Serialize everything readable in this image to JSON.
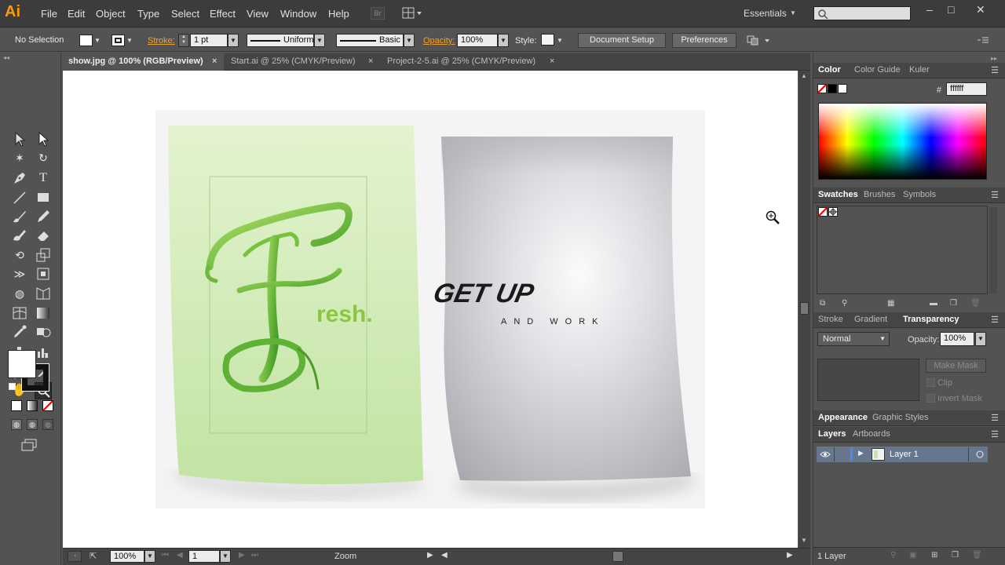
{
  "app": {
    "logo": "Ai"
  },
  "menu": [
    "File",
    "Edit",
    "Object",
    "Type",
    "Select",
    "Effect",
    "View",
    "Window",
    "Help"
  ],
  "bridge_label": "Br",
  "workspace": "Essentials",
  "window_controls": {
    "minimize": "–",
    "restore": "□",
    "close": "✕"
  },
  "control": {
    "selection": "No Selection",
    "stroke_label": "Stroke:",
    "stroke_weight": "1 pt",
    "profile": "Uniform",
    "brush": "Basic",
    "opacity_label": "Opacity:",
    "opacity": "100%",
    "style_label": "Style:",
    "document_setup": "Document Setup",
    "preferences": "Preferences"
  },
  "tabs": [
    {
      "label": "show.jpg @ 100% (RGB/Preview)",
      "close": "×"
    },
    {
      "label": "Start.ai @ 25% (CMYK/Preview)",
      "close": "×"
    },
    {
      "label": "Project-2-5.ai @ 25% (CMYK/Preview)",
      "close": "×"
    }
  ],
  "artwork": {
    "fresh_text": "resh.",
    "getup_text": "GET UP",
    "and_work": "AND WORK"
  },
  "status": {
    "zoom": "100%",
    "artboard": "1",
    "tool": "Zoom"
  },
  "color_panel": {
    "tabs": [
      "Color",
      "Color Guide",
      "Kuler"
    ],
    "hash": "#",
    "hex": "ffffff"
  },
  "swatches_panel": {
    "tabs": [
      "Swatches",
      "Brushes",
      "Symbols"
    ]
  },
  "transparency_panel": {
    "tabs": [
      "Stroke",
      "Gradient",
      "Transparency"
    ],
    "mode": "Normal",
    "opacity_label": "Opacity:",
    "opacity": "100%",
    "make_mask": "Make Mask",
    "clip": "Clip",
    "invert_mask": "Invert Mask"
  },
  "appearance_panel": {
    "tabs": [
      "Appearance",
      "Graphic Styles"
    ]
  },
  "layers_panel": {
    "tabs": [
      "Layers",
      "Artboards"
    ],
    "layer_name": "Layer 1",
    "count": "1 Layer"
  },
  "colors": {
    "accent": "#ff9a00",
    "stroke_label": "#f0a030",
    "fresh_green": "#8cc63f",
    "getup_gold": "#b8a020"
  }
}
